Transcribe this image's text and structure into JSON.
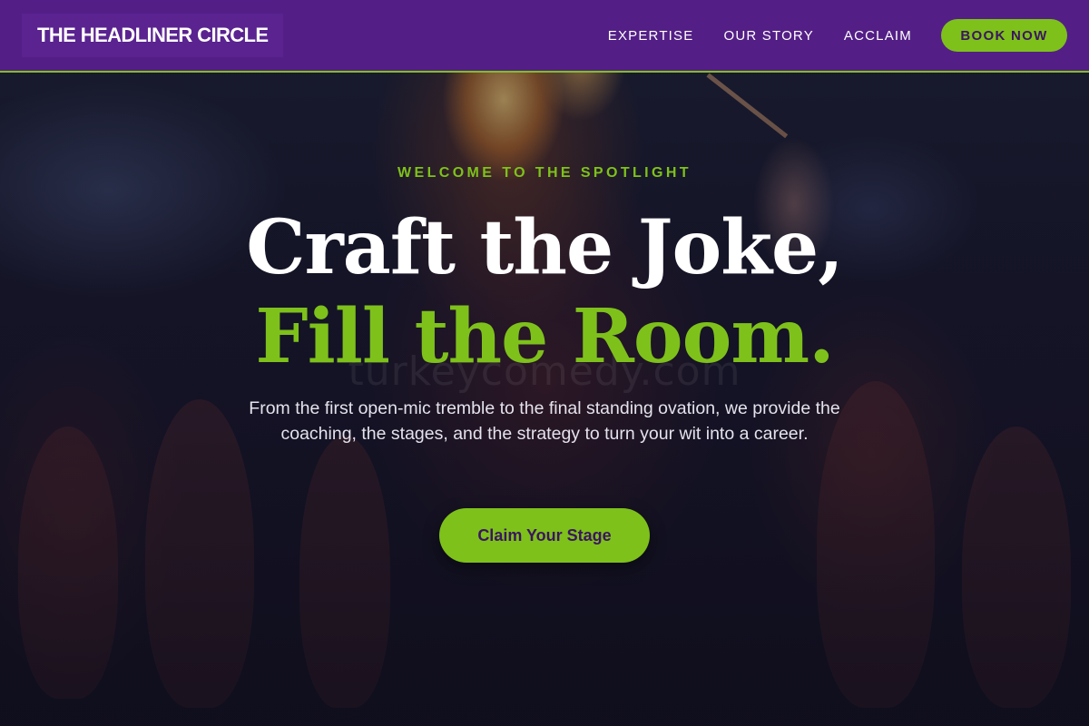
{
  "navbar": {
    "brand": "THE HEADLINER CIRCLE",
    "links": [
      "EXPERTISE",
      "OUR STORY",
      "ACCLAIM"
    ],
    "cta_label": "BOOK NOW"
  },
  "hero": {
    "eyebrow": "WELCOME TO THE SPOTLIGHT",
    "headline_line1": "Craft the Joke,",
    "headline_line2": "Fill the Room.",
    "subtext": "From the first open-mic tremble to the final standing ovation, we provide the coaching, the stages, and the strategy to turn your wit into a career.",
    "cta_label": "Claim Your Stage",
    "watermark": "turkeycomedy.com"
  },
  "colors": {
    "nav_background": "#531f86",
    "accent_green": "#7ec11b",
    "button_text_purple": "#3b1561",
    "hero_dark": "#121121"
  }
}
